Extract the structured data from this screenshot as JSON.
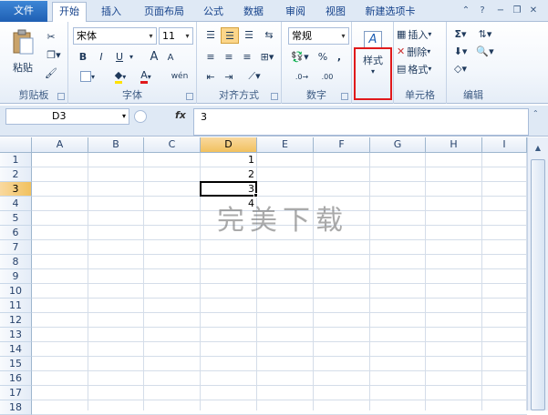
{
  "tabs": [
    {
      "label": "文件"
    },
    {
      "label": "开始"
    },
    {
      "label": "插入"
    },
    {
      "label": "页面布局"
    },
    {
      "label": "公式"
    },
    {
      "label": "数据"
    },
    {
      "label": "审阅"
    },
    {
      "label": "视图"
    },
    {
      "label": "新建选项卡"
    }
  ],
  "ribbon": {
    "clipboard": {
      "paste": "粘贴",
      "label": "剪贴板"
    },
    "font": {
      "name": "宋体",
      "size": "11",
      "bold": "B",
      "italic": "I",
      "underline": "U",
      "label": "字体",
      "grow": "A",
      "shrink": "A",
      "color_a": "A",
      "wen": "wén"
    },
    "align": {
      "label": "对齐方式"
    },
    "number": {
      "format": "常规",
      "percent": "%",
      "comma": ",",
      "label": "数字"
    },
    "styles": {
      "label": "样式"
    },
    "cells": {
      "insert": "插入",
      "delete": "删除",
      "format": "格式",
      "label": "单元格"
    },
    "editing": {
      "label": "编辑"
    }
  },
  "formula": {
    "namebox": "D3",
    "fx": "fx",
    "value": "3"
  },
  "columns": [
    "A",
    "B",
    "C",
    "D",
    "E",
    "F",
    "G",
    "H",
    "I"
  ],
  "rows": [
    "1",
    "2",
    "3",
    "4",
    "5",
    "6",
    "7",
    "8",
    "9",
    "10",
    "11",
    "12",
    "13",
    "14",
    "15",
    "16",
    "17",
    "18"
  ],
  "cells": {
    "D1": "1",
    "D2": "2",
    "D3": "3",
    "D4": "4"
  },
  "watermark": "完美下载",
  "colors": {
    "accent": "#1f5fb3",
    "highlight": "#e0191b",
    "selection_header": "#f1c15f"
  }
}
